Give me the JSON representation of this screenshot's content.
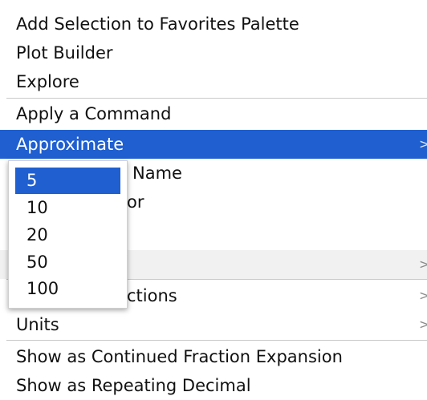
{
  "menu": {
    "items": [
      {
        "label": "Add Selection to Favorites Palette"
      },
      {
        "label": "Plot Builder"
      },
      {
        "label": "Explore"
      },
      {
        "label": "Apply a Command"
      },
      {
        "label": "Approximate",
        "arrow": ">"
      },
      {
        "label": "Name"
      },
      {
        "label": "or"
      },
      {
        "label": "",
        "arrow": ">"
      },
      {
        "label": "ctions",
        "arrow": ">"
      },
      {
        "label": "Units",
        "arrow": ">"
      },
      {
        "label": "Show as Continued Fraction Expansion"
      },
      {
        "label": "Show as Repeating Decimal"
      }
    ]
  },
  "submenu": {
    "items": [
      {
        "label": "5"
      },
      {
        "label": "10"
      },
      {
        "label": "20"
      },
      {
        "label": "50"
      },
      {
        "label": "100"
      }
    ]
  },
  "colors": {
    "highlight": "#1f5fd0",
    "separator": "#c9c9c9",
    "text": "#111111"
  }
}
